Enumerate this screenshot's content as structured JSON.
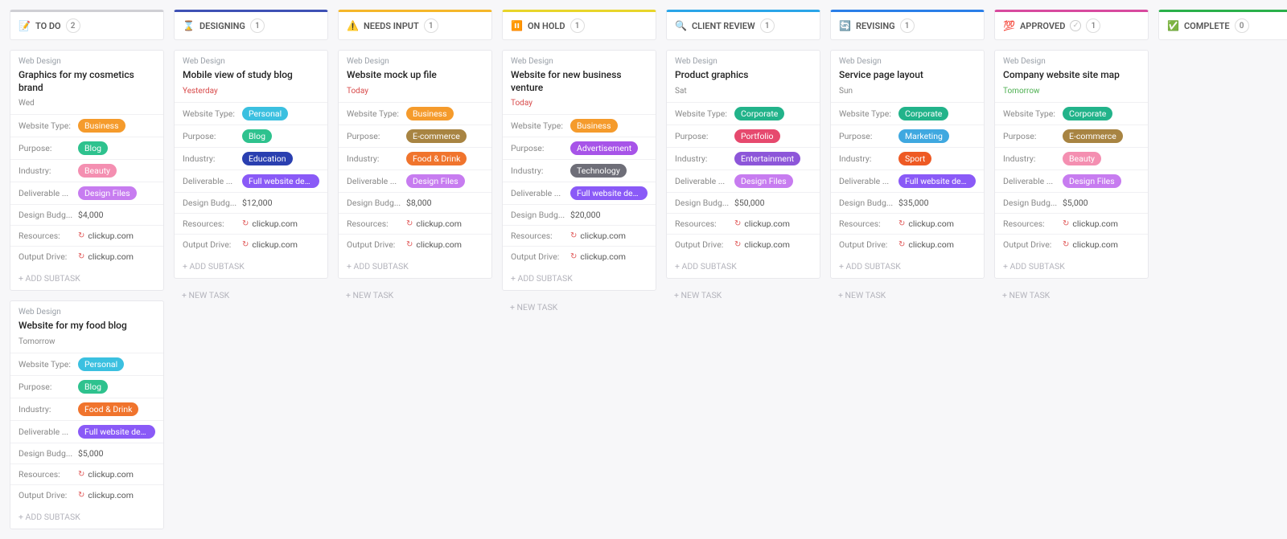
{
  "labels": {
    "add_subtask": "+ ADD SUBTASK",
    "new_task": "+ NEW TASK",
    "website_type": "Website Type:",
    "purpose": "Purpose:",
    "industry": "Industry:",
    "deliverable": "Deliverable ...",
    "budget": "Design Budg...",
    "resources": "Resources:",
    "output_drive": "Output Drive:"
  },
  "link_domain": "clickup.com",
  "columns": [
    {
      "id": "todo",
      "icon": "📝",
      "name": "TO DO",
      "count": "2",
      "top_color": "#cfcfd4",
      "cards": [
        {
          "category": "Web Design",
          "title": "Graphics for my cosmetics brand",
          "date": "Wed",
          "date_color": "#888",
          "website_type": {
            "text": "Business",
            "color": "#f59b2c"
          },
          "purpose": {
            "text": "Blog",
            "color": "#2ec28e"
          },
          "industry": {
            "text": "Beauty",
            "color": "#f48fb1"
          },
          "deliverable": {
            "text": "Design Files",
            "color": "#c77cf0"
          },
          "budget": "$4,000"
        },
        {
          "category": "Web Design",
          "title": "Website for my food blog",
          "date": "Tomorrow",
          "date_color": "#888",
          "website_type": {
            "text": "Personal",
            "color": "#3bc0e0"
          },
          "purpose": {
            "text": "Blog",
            "color": "#2ec28e"
          },
          "industry": {
            "text": "Food & Drink",
            "color": "#f0742d"
          },
          "deliverable": {
            "text": "Full website design and lay...",
            "color": "#8a5af7"
          },
          "budget": "$5,000"
        }
      ]
    },
    {
      "id": "designing",
      "icon": "⌛",
      "name": "DESIGNING",
      "count": "1",
      "top_color": "#3f51b5",
      "cards": [
        {
          "category": "Web Design",
          "title": "Mobile view of study blog",
          "date": "Yesterday",
          "date_color": "#d84a4a",
          "website_type": {
            "text": "Personal",
            "color": "#3bc0e0"
          },
          "purpose": {
            "text": "Blog",
            "color": "#2ec28e"
          },
          "industry": {
            "text": "Education",
            "color": "#2a3fb0"
          },
          "deliverable": {
            "text": "Full website design and lay...",
            "color": "#8a5af7"
          },
          "budget": "$12,000"
        }
      ]
    },
    {
      "id": "needs-input",
      "icon": "⚠️",
      "name": "NEEDS INPUT",
      "count": "1",
      "top_color": "#f5b72a",
      "cards": [
        {
          "category": "Web Design",
          "title": "Website mock up file",
          "date": "Today",
          "date_color": "#d84a4a",
          "website_type": {
            "text": "Business",
            "color": "#f59b2c"
          },
          "purpose": {
            "text": "E-commerce",
            "color": "#a88442"
          },
          "industry": {
            "text": "Food & Drink",
            "color": "#f0742d"
          },
          "deliverable": {
            "text": "Design Files",
            "color": "#c77cf0"
          },
          "budget": "$8,000"
        }
      ]
    },
    {
      "id": "on-hold",
      "icon": "⏸️",
      "name": "ON HOLD",
      "count": "1",
      "top_color": "#e8d52a",
      "cards": [
        {
          "category": "Web Design",
          "title": "Website for new business venture",
          "date": "Today",
          "date_color": "#d84a4a",
          "website_type": {
            "text": "Business",
            "color": "#f59b2c"
          },
          "purpose": {
            "text": "Advertisement",
            "color": "#a754e8"
          },
          "industry": {
            "text": "Technology",
            "color": "#6e6e78"
          },
          "deliverable": {
            "text": "Full website design and lay...",
            "color": "#8a5af7"
          },
          "budget": "$20,000"
        }
      ]
    },
    {
      "id": "client-review",
      "icon": "🔍",
      "name": "CLIENT REVIEW",
      "count": "1",
      "top_color": "#2aa5e8",
      "cards": [
        {
          "category": "Web Design",
          "title": "Product graphics",
          "date": "Sat",
          "date_color": "#888",
          "website_type": {
            "text": "Corporate",
            "color": "#22b38a"
          },
          "purpose": {
            "text": "Portfolio",
            "color": "#e6496e"
          },
          "industry": {
            "text": "Entertainment",
            "color": "#8d56d9"
          },
          "deliverable": {
            "text": "Design Files",
            "color": "#c77cf0"
          },
          "budget": "$50,000"
        }
      ]
    },
    {
      "id": "revising",
      "icon": "🔄",
      "name": "REVISING",
      "count": "1",
      "top_color": "#2a7ee8",
      "cards": [
        {
          "category": "Web Design",
          "title": "Service page layout",
          "date": "Sun",
          "date_color": "#888",
          "website_type": {
            "text": "Corporate",
            "color": "#22b38a"
          },
          "purpose": {
            "text": "Marketing",
            "color": "#3fa8e0"
          },
          "industry": {
            "text": "Sport",
            "color": "#ee5a24"
          },
          "deliverable": {
            "text": "Full website design and lay...",
            "color": "#8a5af7"
          },
          "budget": "$35,000"
        }
      ]
    },
    {
      "id": "approved",
      "icon": "💯",
      "name": "APPROVED",
      "count": "1",
      "top_color": "#d84a9e",
      "approved_check": true,
      "cards": [
        {
          "category": "Web Design",
          "title": "Company website site map",
          "date": "Tomorrow",
          "date_color": "#4caf50",
          "website_type": {
            "text": "Corporate",
            "color": "#22b38a"
          },
          "purpose": {
            "text": "E-commerce",
            "color": "#a88442"
          },
          "industry": {
            "text": "Beauty",
            "color": "#f48fb1"
          },
          "deliverable": {
            "text": "Design Files",
            "color": "#c77cf0"
          },
          "budget": "$5,000"
        }
      ]
    },
    {
      "id": "complete",
      "icon": "✅",
      "name": "COMPLETE",
      "count": "0",
      "top_color": "#2ab04a",
      "cards": []
    }
  ]
}
